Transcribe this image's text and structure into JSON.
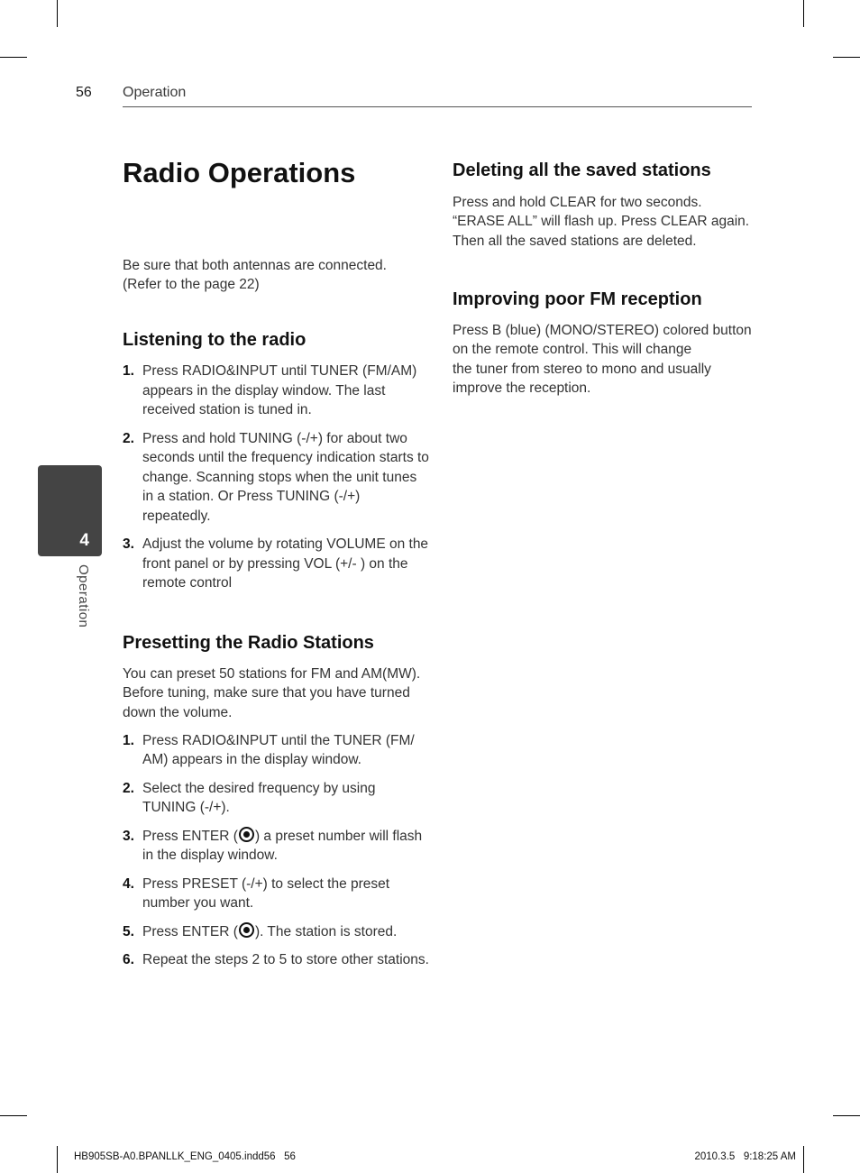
{
  "header": {
    "page_number": "56",
    "section": "Operation"
  },
  "side_tab": {
    "chapter_number": "4",
    "chapter_label": "Operation"
  },
  "title": "Radio Operations",
  "intro": [
    "Be sure that both antennas are connected.",
    "(Refer to the page 22)"
  ],
  "listening": {
    "heading": "Listening to the radio",
    "steps": [
      {
        "num": "1.",
        "text": "Press RADIO&INPUT until TUNER (FM/AM) appears in the display window. The last received station is tuned in."
      },
      {
        "num": "2.",
        "text": "Press and hold TUNING (-/+) for about two seconds until the frequency indication starts to change. Scanning stops when the unit tunes in a station. Or Press TUNING (-/+) repeatedly."
      },
      {
        "num": "3.",
        "text": "Adjust the volume by rotating VOLUME on the front panel or by pressing VOL (+/- ) on the remote control"
      }
    ]
  },
  "presetting": {
    "heading": "Presetting the Radio Stations",
    "intro": "You can preset 50 stations for FM and AM(MW). Before tuning, make sure that you have turned down the volume.",
    "steps": [
      {
        "num": "1.",
        "text": "Press RADIO&INPUT until the TUNER (FM/ AM) appears in the display window."
      },
      {
        "num": "2.",
        "text": "Select the desired frequency by using TUNING (-/+)."
      },
      {
        "num": "3.",
        "before": "Press ENTER (",
        "icon": "enter-icon",
        "after": ") a preset number will flash in the display window."
      },
      {
        "num": "4.",
        "text": "Press PRESET (-/+) to select the preset number you want."
      },
      {
        "num": "5.",
        "before": "Press ENTER (",
        "icon": "enter-icon",
        "after": "). The station is stored."
      },
      {
        "num": "6.",
        "text": "Repeat the steps 2 to 5 to store other stations."
      }
    ]
  },
  "deleting": {
    "heading": "Deleting all the saved stations",
    "lines": [
      "Press and hold CLEAR for two seconds.",
      "“ERASE ALL” will flash up. Press CLEAR again.",
      "Then all the saved stations are deleted."
    ]
  },
  "improving": {
    "heading": "Improving poor FM reception",
    "lines": [
      "Press B (blue) (MONO/STEREO) colored button",
      "on the remote control. This will change",
      "the tuner from stereo to mono and usually",
      "improve the reception."
    ]
  },
  "footer": {
    "file": "HB905SB-A0.BPANLLK_ENG_0405.indd56   56",
    "timestamp": "2010.3.5   9:18:25 AM"
  }
}
